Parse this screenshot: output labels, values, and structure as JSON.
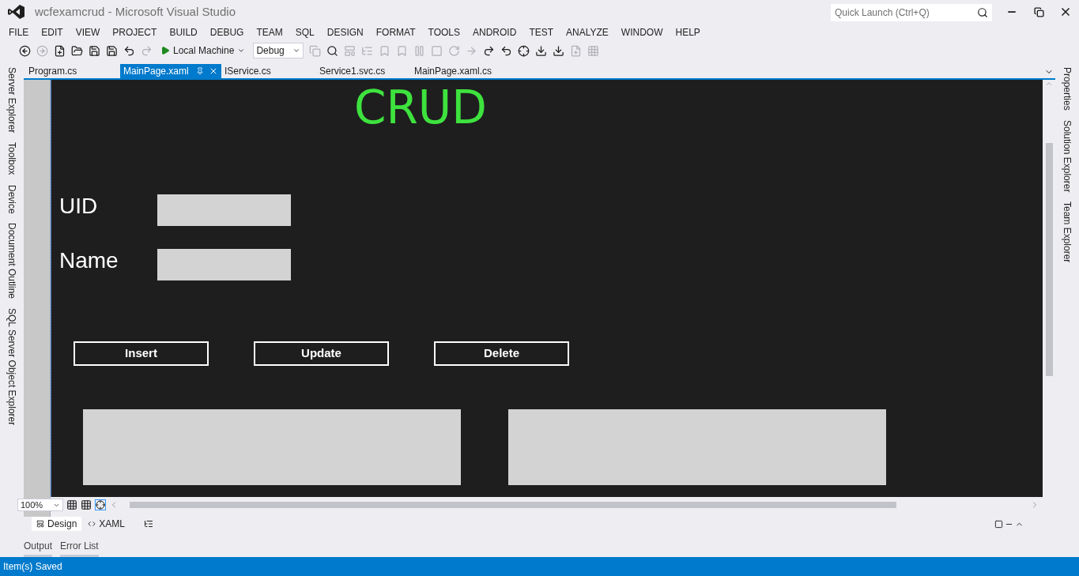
{
  "window": {
    "title": "wcfexamcrud - Microsoft Visual Studio"
  },
  "quick_launch": {
    "placeholder": "Quick Launch (Ctrl+Q)"
  },
  "menu": [
    "FILE",
    "EDIT",
    "VIEW",
    "PROJECT",
    "BUILD",
    "DEBUG",
    "TEAM",
    "SQL",
    "DESIGN",
    "FORMAT",
    "TOOLS",
    "ANDROID",
    "TEST",
    "ANALYZE",
    "WINDOW",
    "HELP"
  ],
  "toolbar": {
    "run_target": "Local Machine",
    "configuration": "Debug"
  },
  "tabs": [
    {
      "label": "Program.cs",
      "selected": false
    },
    {
      "label": "MainPage.xaml",
      "selected": true
    },
    {
      "label": "IService.cs",
      "selected": false
    },
    {
      "label": "Service1.svc.cs",
      "selected": false
    },
    {
      "label": "MainPage.xaml.cs",
      "selected": false
    }
  ],
  "left_rail": [
    "Server Explorer",
    "Toolbox",
    "Device",
    "Document Outline",
    "SQL Server Object Explorer"
  ],
  "right_rail": [
    "Properties",
    "Solution Explorer",
    "Team Explorer"
  ],
  "designer": {
    "heading": "CRUD",
    "fields": [
      {
        "label": "UID"
      },
      {
        "label": "Name"
      }
    ],
    "buttons": [
      "Insert",
      "Update",
      "Delete"
    ]
  },
  "zoom": "100%",
  "view_tabs": [
    {
      "label": "Design",
      "selected": true
    },
    {
      "label": "XAML",
      "selected": false
    }
  ],
  "bottom_tabs": [
    "Output",
    "Error List"
  ],
  "status_bar": "Item(s) Saved"
}
